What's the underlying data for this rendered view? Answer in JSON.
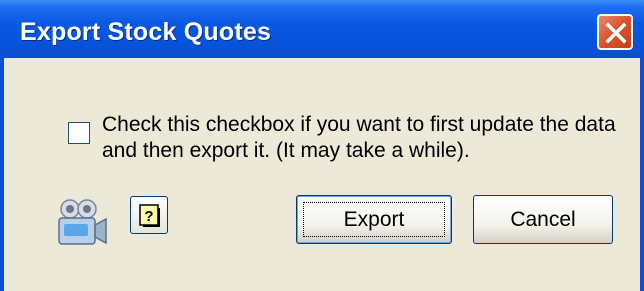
{
  "window": {
    "title": "Export Stock Quotes",
    "accent_color": "#0a58e2",
    "close_icon": "close-icon"
  },
  "content": {
    "checkbox_checked": false,
    "checkbox_label": "Check this checkbox if you want to first update the data and then export it. (It may take a while)."
  },
  "footer": {
    "video_icon": "video-camera-icon",
    "help_icon": "question-mark-icon",
    "export_label": "Export",
    "cancel_label": "Cancel"
  }
}
